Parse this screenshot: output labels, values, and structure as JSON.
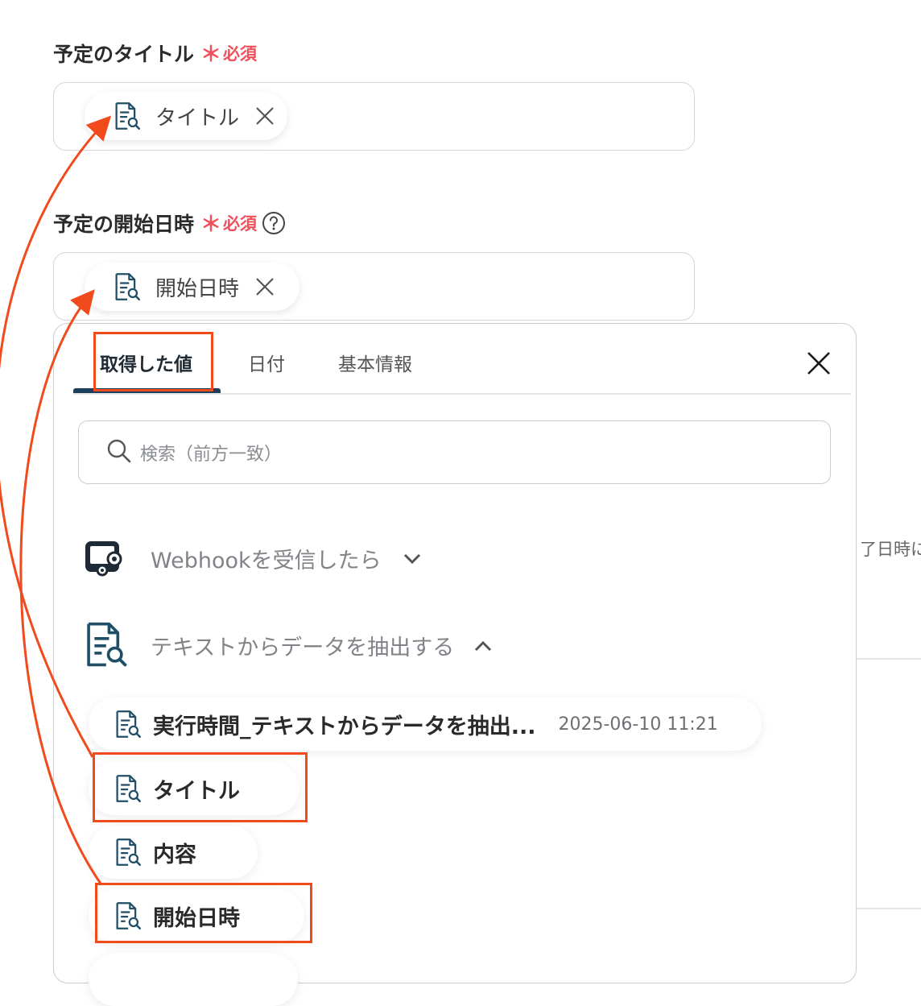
{
  "title_field": {
    "label": "予定のタイトル",
    "required_mark": "＊",
    "required_text": "必須",
    "chip_label": "タイトル"
  },
  "start_field": {
    "label": "予定の開始日時",
    "required_mark": "＊",
    "required_text": "必須",
    "chip_label": "開始日時"
  },
  "panel": {
    "tabs": [
      "取得した値",
      "日付",
      "基本情報"
    ],
    "search_placeholder": "検索（前方一致）",
    "sections": [
      {
        "title": "Webhookを受信したら"
      },
      {
        "title": "テキストからデータを抽出する"
      }
    ],
    "items": [
      {
        "label": "実行時間_テキストからデータを抽出...",
        "value": "2025-06-10 11:21"
      },
      {
        "label": "タイトル"
      },
      {
        "label": "内容"
      },
      {
        "label": "開始日時"
      }
    ]
  },
  "background": {
    "partial_text": "了日時に"
  },
  "colors": {
    "required": "#f0505a",
    "highlight": "#f14a1c",
    "tab_active": "#1a3f5c",
    "icon": "#1f4e66"
  },
  "icons": [
    "document-search-icon",
    "close-icon",
    "help-icon",
    "search-icon",
    "webhook-icon",
    "chevron-down-icon",
    "chevron-up-icon"
  ]
}
